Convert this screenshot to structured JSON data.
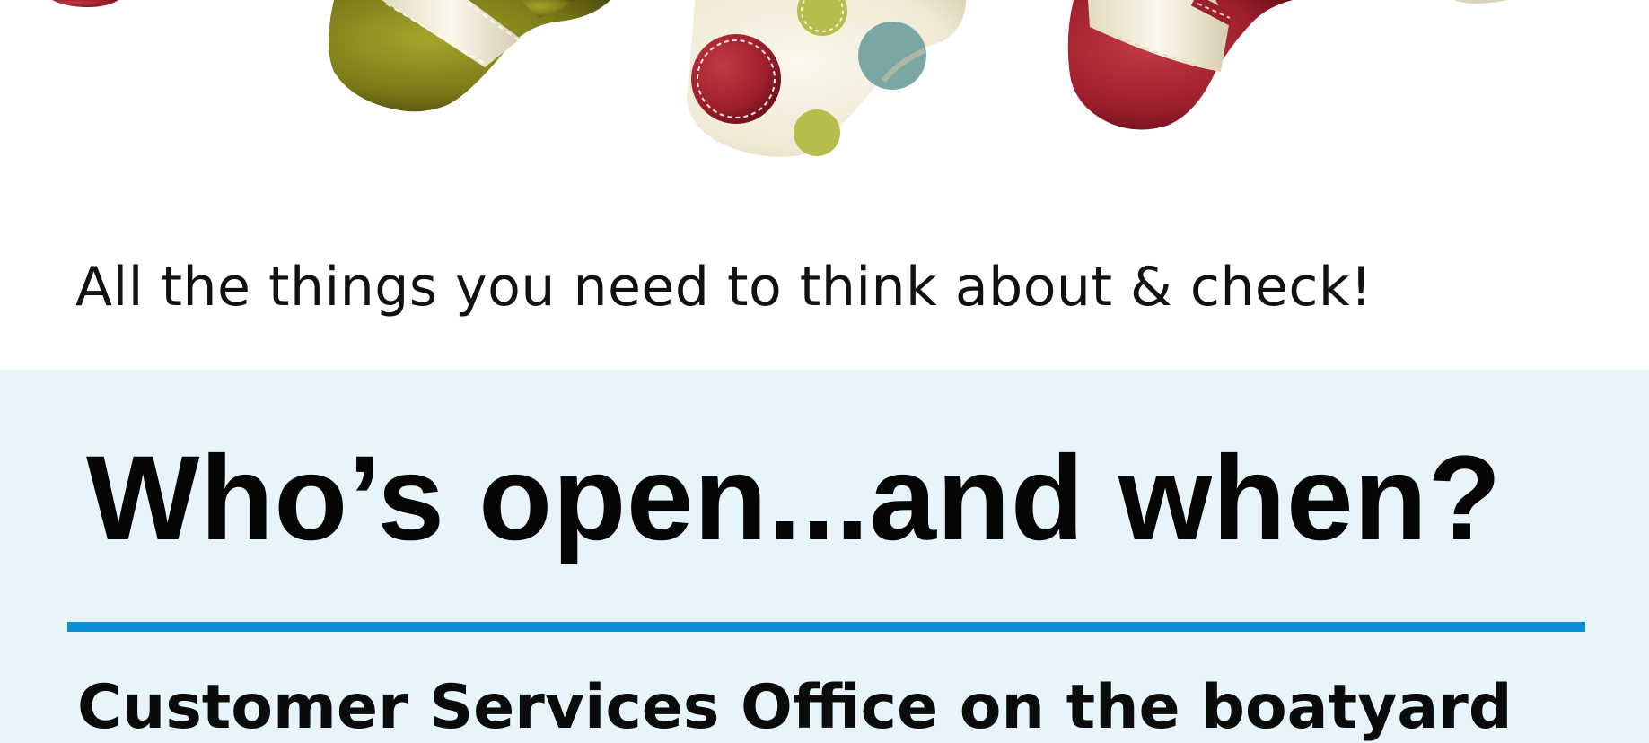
{
  "hero": {
    "image_name": "christmas-stockings-illustration",
    "colors": {
      "olive": "#7b7a18",
      "cream": "#efe9d4",
      "red": "#9e1f2c",
      "teal": "#7aa7a4",
      "lime": "#b7bd4c"
    }
  },
  "intro": {
    "subtitle": "All the things you need to think about & check!"
  },
  "opening_hours": {
    "heading": "Who’s open...and when?",
    "section_title": "Customer Services Office on the boatyard",
    "panel_color": "#e7f4f9",
    "rule_color": "#0891d6"
  }
}
